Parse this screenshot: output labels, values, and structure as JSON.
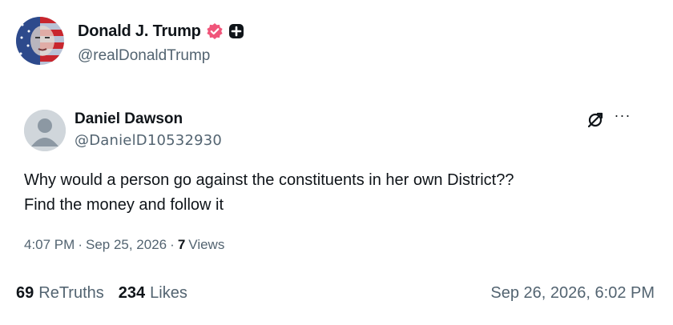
{
  "author": {
    "name": "Donald J. Trump",
    "handle": "@realDonaldTrump"
  },
  "embedded_post": {
    "name": "Daniel Dawson",
    "handle": "@DanielD10532930",
    "text_line1": "Why would a person go against the constituents in her own District??",
    "text_line2": "Find the money and follow it",
    "time": "4:07 PM",
    "sep1": "·",
    "date": "Sep 25, 2026",
    "sep2": "·",
    "views_count": "7",
    "views_label": "Views",
    "more_label": "···"
  },
  "stats": {
    "retruths_count": "69",
    "retruths_label": "ReTruths",
    "likes_count": "234",
    "likes_label": "Likes"
  },
  "timestamp": "Sep 26, 2026, 6:02 PM",
  "colors": {
    "text": "#0f1419",
    "muted": "#536471",
    "verified": "#f0557a"
  },
  "icons": {
    "verified": "verified-badge-icon",
    "plus": "plus-badge-icon",
    "sync": "sync-icon",
    "more": "more-icon"
  }
}
